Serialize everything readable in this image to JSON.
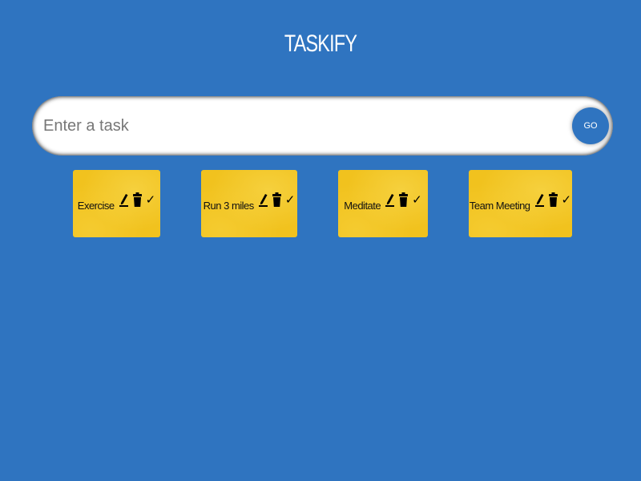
{
  "app": {
    "title": "TASKIFY"
  },
  "form": {
    "placeholder": "Enter a task",
    "value": "",
    "submit_label": "GO"
  },
  "tasks": [
    {
      "text": "Exercise"
    },
    {
      "text": "Run 3 miles"
    },
    {
      "text": "Meditate"
    },
    {
      "text": "Team Meeting"
    }
  ],
  "icons": {
    "edit": "edit-icon",
    "delete": "delete-icon",
    "done": "check-icon",
    "done_glyph": "✓"
  },
  "colors": {
    "background": "#2f74c0",
    "card": "#f1c21e",
    "title": "#ffffff",
    "button": "#2f74c0"
  }
}
